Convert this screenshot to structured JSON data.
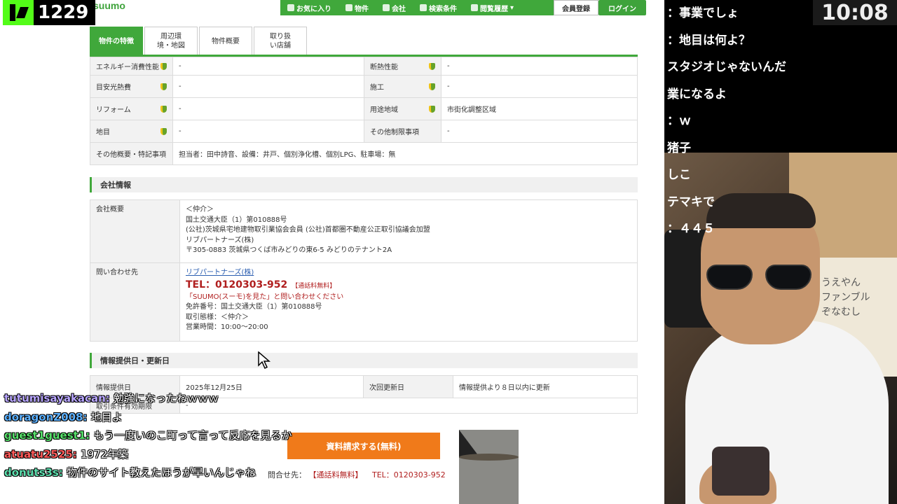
{
  "stream": {
    "viewer_count": "1229",
    "clock": "10:08"
  },
  "header": {
    "logo_text": "suumo",
    "nav": {
      "favorites": "お気に入り",
      "property": "物件",
      "company": "会社",
      "search_conditions": "検索条件",
      "history": "閲覧履歴"
    },
    "member_register": "会員登録",
    "login": "ログイン"
  },
  "tabs": [
    {
      "label": "物件の特徴"
    },
    {
      "label": "周辺環境・地図"
    },
    {
      "label": "物件概要"
    },
    {
      "label": "取り扱い店舗"
    }
  ],
  "spec": {
    "rows": [
      {
        "l_label": "エネルギー消費性能",
        "l_value": "-",
        "r_label": "断熱性能",
        "r_value": "-"
      },
      {
        "l_label": "目安光熱費",
        "l_value": "-",
        "r_label": "施工",
        "r_value": "-"
      },
      {
        "l_label": "リフォーム",
        "l_value": "-",
        "r_label": "用途地域",
        "r_value": "市街化調整区域"
      },
      {
        "l_label": "地目",
        "l_value": "-",
        "r_label": "その他制限事項",
        "r_value": "-"
      }
    ],
    "other_label": "その他概要・特記事項",
    "other_value": "担当者：田中詩音、設備：井戸、個別浄化槽、個別LPG、駐車場：無"
  },
  "company": {
    "section_title": "会社情報",
    "overview_label": "会社概要",
    "overview_lines": [
      "＜仲介＞",
      "国土交通大臣（1）第010888号",
      "(公社)茨城県宅地建物取引業協会会員 (公社)首都圏不動産公正取引協議会加盟",
      "リブパートナーズ(株)",
      "〒305-0883 茨城県つくば市みどりの東6-5 みどりのテナント2A"
    ],
    "inquiry_label": "問い合わせ先",
    "inquiry_company": "リブパートナーズ(株)",
    "tel": "TEL：0120303-952",
    "tel_badge": "【通話料無料】",
    "note": "「SUUMO(スーモ)を見た」と問い合わせください",
    "license": "免許番号：国土交通大臣（1）第010888号",
    "transaction": "取引態様：＜仲介＞",
    "hours": "営業時間：10:00～20:00"
  },
  "dates": {
    "section_title": "情報提供日・更新日",
    "provided_label": "情報提供日",
    "provided_value": "2025年12月25日",
    "next_update_label": "次回更新日",
    "next_update_value": "情報提供より８日以内に更新",
    "validity_label": "取引条件有効期限",
    "validity_value": "-"
  },
  "cta": {
    "button_label": "資料請求する(無料)",
    "contact_prefix": "問合せ先：",
    "contact_badge": "【通話料無料】",
    "contact_tel": "TEL：0120303-952"
  },
  "overlay_chat": [
    {
      "user": "tutumisayakacan:",
      "user_color": "#b8a6ff",
      "msg": "勉強になったねｗｗｗ"
    },
    {
      "user": "doragonZ008:",
      "user_color": "#5db1ff",
      "msg": "地目よ"
    },
    {
      "user": "guest1guest1:",
      "user_color": "#57e06b",
      "msg": "もう一度いのこ町って言って反応を見るか"
    },
    {
      "user": "atuatu2525:",
      "user_color": "#ff5a5a",
      "msg": "1972年築"
    },
    {
      "user": "donuts3s:",
      "user_color": "#5fe0b0",
      "msg": "物件のサイト教えたほうが早いんじゃね"
    }
  ],
  "side_chat": [
    "：事業でしょ",
    "：地目は何よ？",
    "スタジオじゃないんだ",
    "業になるよ",
    "：ｗ",
    "猪子",
    "しこ",
    "テマキで",
    "：４４５"
  ],
  "poster_text": [
    "うえやん",
    "ファンブル",
    "ぞなむし"
  ]
}
